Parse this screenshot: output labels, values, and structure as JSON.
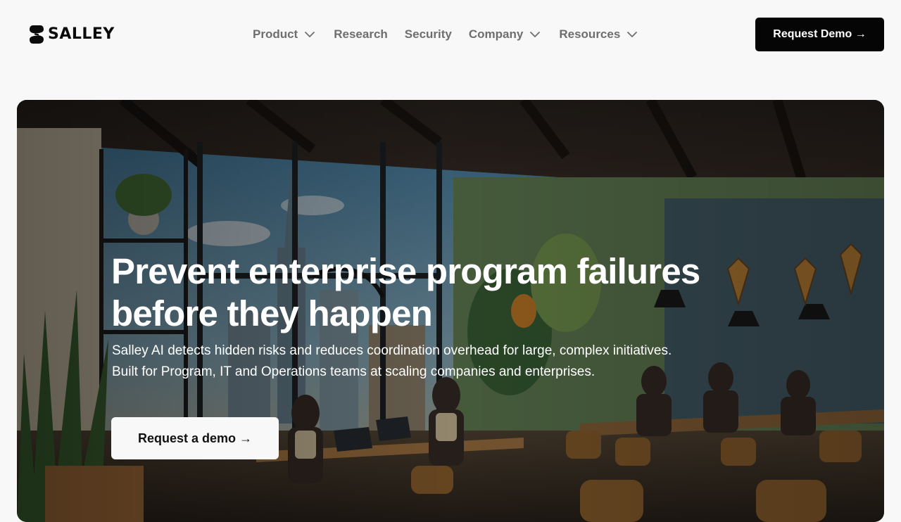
{
  "brand": {
    "name": "SALLEY"
  },
  "nav": {
    "product": "Product",
    "research": "Research",
    "security": "Security",
    "company": "Company",
    "resources": "Resources"
  },
  "header_cta": "Request Demo →",
  "hero": {
    "title_line1": "Prevent enterprise program failures",
    "title_line2": "before they happen",
    "subtitle_line1": "Salley AI detects hidden risks and reduces coordination overhead for large, complex initiatives.",
    "subtitle_line2": "Built for Program, IT and Operations teams at scaling companies and enterprises.",
    "cta": "Request a demo →"
  },
  "icons": {
    "logo": "salley-s-logo-icon",
    "dropdown": "chevron-down-icon"
  },
  "colors": {
    "page_bg": "#f8f8f8",
    "nav_text": "#6e6e6e",
    "primary_button": "#050505",
    "hero_text": "#ffffff"
  }
}
